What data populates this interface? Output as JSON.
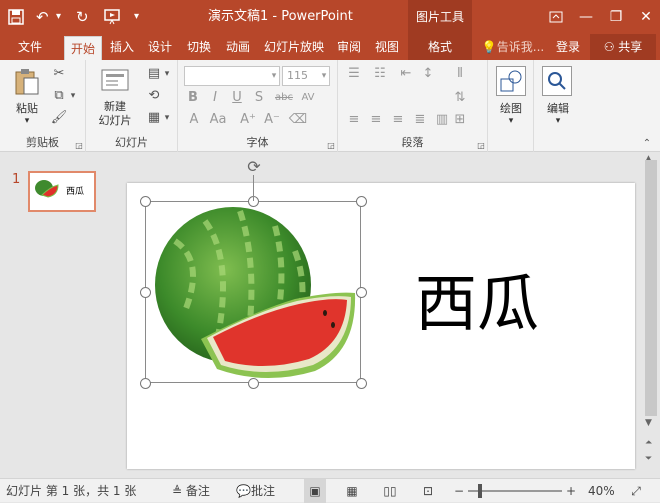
{
  "title_bar": {
    "document_title": "演示文稿1 - PowerPoint",
    "context_tool_group": "图片工具",
    "qat_icons": [
      "save-icon",
      "undo-icon",
      "redo-icon",
      "start-slideshow-icon",
      "customize-icon"
    ]
  },
  "tabs": [
    {
      "label": "文件"
    },
    {
      "label": "开始"
    },
    {
      "label": "插入"
    },
    {
      "label": "设计"
    },
    {
      "label": "切换"
    },
    {
      "label": "动画"
    },
    {
      "label": "幻灯片放映"
    },
    {
      "label": "审阅"
    },
    {
      "label": "视图"
    },
    {
      "label": "格式"
    }
  ],
  "active_tab": "开始",
  "tell_me": "告诉我...",
  "sign_in": "登录",
  "share": "共享",
  "ribbon": {
    "clipboard": {
      "paste_label": "粘贴",
      "group_label": "剪贴板"
    },
    "slides": {
      "new_slide_label": "新建\n幻灯片",
      "group_label": "幻灯片"
    },
    "font": {
      "font_name_value": "",
      "font_size_value": "115",
      "group_label": "字体"
    },
    "paragraph": {
      "group_label": "段落"
    },
    "drawing": {
      "label": "绘图"
    },
    "editing": {
      "label": "编辑"
    }
  },
  "thumbnail": {
    "number": "1",
    "text": "西瓜"
  },
  "slide": {
    "text": "西瓜"
  },
  "status_bar": {
    "slide_info": "幻灯片 第 1 张，共 1 张",
    "notes": "备注",
    "comments": "批注",
    "zoom_percent": "40%"
  },
  "colors": {
    "accent": "#b7472a",
    "context": "#a03b22",
    "ribbon_bg": "#f3f3f3"
  }
}
